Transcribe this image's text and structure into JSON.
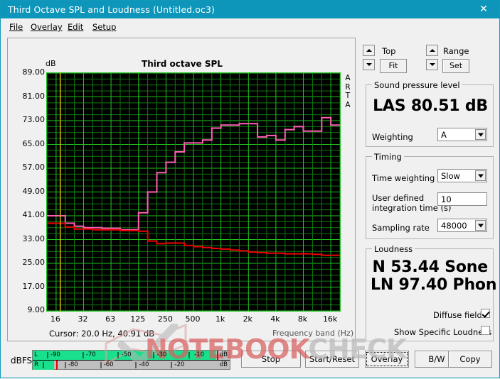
{
  "window": {
    "title": "Third Octave SPL and Loudness (Untitled.oc3)",
    "close_icon": "close-icon",
    "titlebar_color": "#0e96ba"
  },
  "menu": [
    {
      "label": "File"
    },
    {
      "label": "Overlay"
    },
    {
      "label": "Edit"
    },
    {
      "label": "Setup"
    }
  ],
  "chart_panel": {
    "title": "Third octave SPL",
    "y_axis_unit": "dB",
    "watermark_brand": "ARTA",
    "cursor_text": "Cursor:   20.0 Hz, 40.91 dB",
    "x_axis_label": "Frequency band (Hz)"
  },
  "chart_data": {
    "type": "line",
    "title": "Third octave SPL",
    "xlabel": "Frequency band (Hz)",
    "ylabel": "dB",
    "ylim": [
      9,
      89
    ],
    "ytick_labels": [
      "89.00",
      "81.00",
      "73.00",
      "65.00",
      "57.00",
      "49.00",
      "41.00",
      "33.00",
      "25.00",
      "17.00",
      "9.00"
    ],
    "yticks": [
      89,
      81,
      73,
      65,
      57,
      49,
      41,
      33,
      25,
      17,
      9
    ],
    "xtick_labels": [
      "16",
      "32",
      "63",
      "125",
      "250",
      "500",
      "1k",
      "2k",
      "4k",
      "8k",
      "16k"
    ],
    "grid": true,
    "grid_color": "#0f7a0f",
    "grid_major_color": "#21c521",
    "background": "#000000",
    "cursor_line": {
      "frequency_hz": 20.0,
      "value_db": 40.91,
      "color": "#d8c000"
    },
    "bands": [
      16,
      20,
      25,
      31.5,
      40,
      50,
      63,
      80,
      100,
      125,
      160,
      200,
      250,
      315,
      400,
      500,
      630,
      800,
      1000,
      1250,
      1600,
      2000,
      2500,
      3150,
      4000,
      5000,
      6300,
      8000,
      10000,
      12500,
      16000,
      20000
    ],
    "series": [
      {
        "name": "pink-spl-curve",
        "color": "#ff5fb4",
        "style": "step",
        "values": [
          41.0,
          41.0,
          38.5,
          37.5,
          37.0,
          37.0,
          36.8,
          36.8,
          36.3,
          36.3,
          42.0,
          49.0,
          55.5,
          59.0,
          62.5,
          65.5,
          65.5,
          66.5,
          70.5,
          71.5,
          71.5,
          72.0,
          72.0,
          67.5,
          68.0,
          66.5,
          70.0,
          71.0,
          69.5,
          69.5,
          74.0,
          71.5
        ]
      },
      {
        "name": "red-noise-floor-curve",
        "color": "#ee0000",
        "style": "step",
        "values": [
          38.5,
          38.5,
          37.2,
          36.5,
          36.5,
          36.3,
          36.3,
          36.3,
          36.0,
          36.0,
          35.8,
          32.5,
          31.6,
          31.8,
          31.8,
          31.0,
          30.6,
          30.3,
          30.0,
          29.8,
          29.5,
          29.2,
          28.8,
          28.6,
          28.4,
          28.4,
          28.2,
          28.2,
          28.2,
          28.0,
          27.7,
          27.7
        ]
      }
    ]
  },
  "top_controls": {
    "top_label": "Top",
    "fit_label": "Fit",
    "range_label": "Range",
    "set_label": "Set"
  },
  "sound_pressure_level": {
    "group_title": "Sound pressure level",
    "reading": "LAS 80.51 dB",
    "weighting_label": "Weighting",
    "weighting_value": "A"
  },
  "timing": {
    "group_title": "Timing",
    "time_weighting_label": "Time weighting",
    "time_weighting_value": "Slow",
    "integration_label_line1": "User defined",
    "integration_label_line2": "integration time (s)",
    "integration_value": "10",
    "sampling_rate_label": "Sampling rate",
    "sampling_rate_value": "48000"
  },
  "loudness": {
    "group_title": "Loudness",
    "sone_reading": "N 53.44 Sone",
    "phon_reading": "LN 97.40 Phon",
    "diffuse_field_label": "Diffuse field",
    "diffuse_field_checked": true,
    "specific_loudness_label": "Show Specific Loudness",
    "specific_loudness_checked": false
  },
  "meters": {
    "unit_label": "dBFS",
    "db_suffix": "dB",
    "rows": [
      {
        "channel": "L",
        "fill_percent": 93.0,
        "peak_percent": 93.5,
        "ticks": [
          "-90",
          "-70",
          "-50",
          "-30",
          "-10"
        ]
      },
      {
        "channel": "R",
        "fill_percent": 11.0,
        "peak_percent": 12.0,
        "ticks": [
          "-80",
          "-60",
          "-40",
          "-20"
        ]
      }
    ]
  },
  "bottom_buttons": [
    {
      "label": "Stop",
      "focused": false
    },
    {
      "label": "Start/Reset",
      "focused": false
    },
    {
      "label": "Overlay",
      "focused": true
    },
    {
      "label": "B/W",
      "focused": false
    },
    {
      "label": "Copy",
      "focused": false
    }
  ],
  "watermark": {
    "part1": "NOTEBOOK",
    "part2": "CHECK"
  }
}
